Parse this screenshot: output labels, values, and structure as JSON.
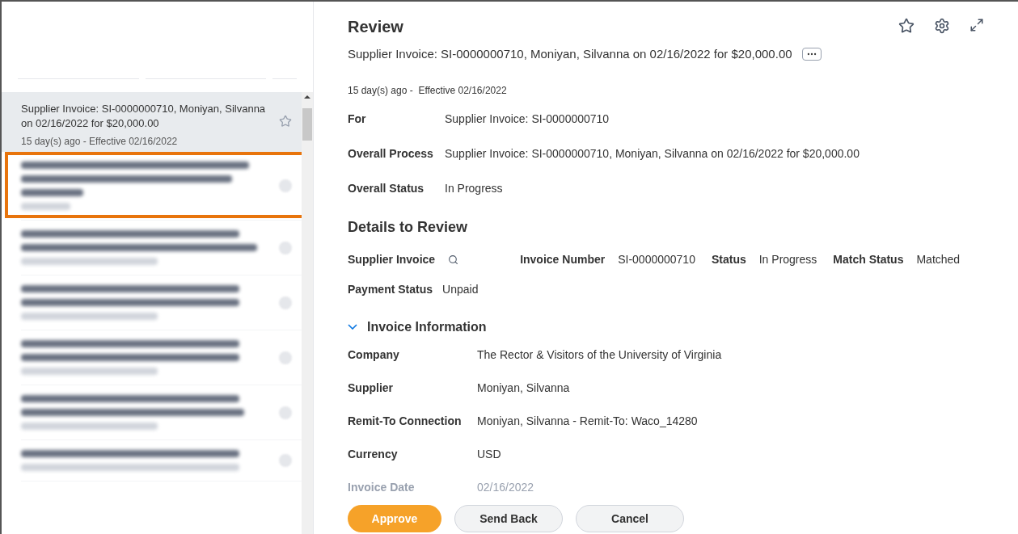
{
  "inbox": {
    "items": [
      {
        "title": "Supplier Invoice: SI-0000000710, Moniyan, Silvanna on 02/16/2022 for $20,000.00",
        "meta": "15 day(s) ago - Effective 02/16/2022",
        "selected": true,
        "starred": false
      }
    ]
  },
  "review": {
    "heading": "Review",
    "subtitle": "Supplier Invoice: SI-0000000710, Moniyan, Silvanna on 02/16/2022 for $20,000.00",
    "meta": "15 day(s) ago -  Effective 02/16/2022",
    "summary": [
      {
        "label": "For",
        "value": "Supplier Invoice: SI-0000000710"
      },
      {
        "label": "Overall Process",
        "value": "Supplier Invoice: SI-0000000710, Moniyan, Silvanna on 02/16/2022 for $20,000.00"
      },
      {
        "label": "Overall Status",
        "value": "In Progress"
      }
    ],
    "details_heading": "Details to Review",
    "details": [
      {
        "label": "Supplier Invoice",
        "kind": "search"
      },
      {
        "label": "Invoice Number",
        "value": "SI-0000000710",
        "kind": "text"
      },
      {
        "label": "Status",
        "value": "In Progress",
        "kind": "text"
      },
      {
        "label": "Match Status",
        "value": "Matched",
        "kind": "text"
      }
    ],
    "payment": {
      "label": "Payment Status",
      "value": "Unpaid"
    },
    "section": {
      "title": "Invoice Information",
      "expanded": true
    },
    "fields": [
      {
        "label": "Company",
        "value": "The Rector & Visitors of the University of Virginia",
        "faded": false
      },
      {
        "label": "Supplier",
        "value": "Moniyan, Silvanna",
        "faded": false
      },
      {
        "label": "Remit-To Connection",
        "value": "Moniyan, Silvanna - Remit-To: Waco_14280",
        "faded": false
      },
      {
        "label": "Currency",
        "value": "USD",
        "faded": false
      },
      {
        "label": "Invoice Date",
        "value": "02/16/2022",
        "faded": true
      }
    ],
    "buttons": [
      {
        "label": "Approve",
        "kind": "primary"
      },
      {
        "label": "Send Back",
        "kind": "secondary"
      },
      {
        "label": "Cancel",
        "kind": "secondary"
      }
    ]
  }
}
